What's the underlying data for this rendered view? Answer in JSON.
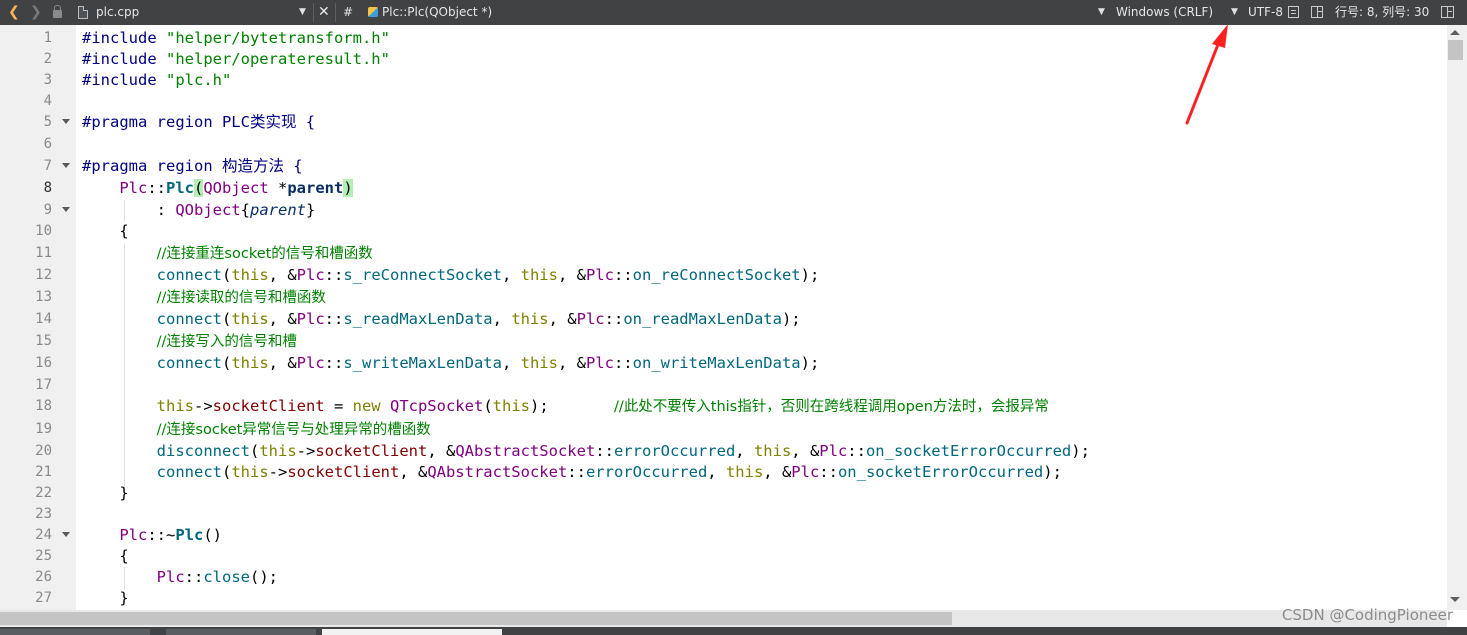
{
  "toolbar": {
    "back_glyph": "❮",
    "forward_glyph": "❯",
    "file_name": "plc.cpp",
    "close_glyph": "✕",
    "hash_glyph": "#",
    "symbol": "Plc::Plc(QObject *)",
    "line_ending": "Windows (CRLF)",
    "encoding": "UTF-8",
    "position": "行号: 8, 列号: 30",
    "dropdown_caret": "▼"
  },
  "editor": {
    "current_line": 8,
    "line_numbers": [
      "1",
      "2",
      "3",
      "4",
      "5",
      "6",
      "7",
      "8",
      "9",
      "10",
      "11",
      "12",
      "13",
      "14",
      "15",
      "16",
      "17",
      "18",
      "19",
      "20",
      "21",
      "22",
      "23",
      "24",
      "25",
      "26",
      "27"
    ],
    "lines": {
      "l1": {
        "kw": "#include",
        "rest": " \"helper/bytetransform.h\""
      },
      "l2": {
        "kw": "#include",
        "rest": " \"helper/operateresult.h\""
      },
      "l3": {
        "kw": "#include",
        "rest": " \"plc.h\""
      },
      "l5": {
        "text": "#pragma region PLC类实现 {"
      },
      "l7": {
        "text": "#pragma region 构造方法 {"
      },
      "l8": {
        "cls": "Plc",
        "sep": "::",
        "fn": "Plc",
        "open": "(",
        "type": "QObject",
        "star": " *",
        "param": "parent",
        "close": ")"
      },
      "l9": {
        "colon": ": ",
        "cls": "QObject",
        "open": "{",
        "param": "parent",
        "close": "}"
      },
      "l10": {
        "text": "{"
      },
      "l11": {
        "comment": "//连接重连socket的信号和槽函数"
      },
      "l12": {
        "fn": "connect",
        "a": "(",
        "this1": "this",
        "b": ", &",
        "cls1": "Plc",
        "c": "::",
        "sig": "s_reConnectSocket",
        "d": ", ",
        "this2": "this",
        "e": ", &",
        "cls2": "Plc",
        "f": "::",
        "slot": "on_reConnectSocket",
        "g": ");"
      },
      "l13": {
        "comment": "//连接读取的信号和槽函数"
      },
      "l14": {
        "fn": "connect",
        "a": "(",
        "this1": "this",
        "b": ", &",
        "cls1": "Plc",
        "c": "::",
        "sig": "s_readMaxLenData",
        "d": ", ",
        "this2": "this",
        "e": ", &",
        "cls2": "Plc",
        "f": "::",
        "slot": "on_readMaxLenData",
        "g": ");"
      },
      "l15": {
        "comment": "//连接写入的信号和槽"
      },
      "l16": {
        "fn": "connect",
        "a": "(",
        "this1": "this",
        "b": ", &",
        "cls1": "Plc",
        "c": "::",
        "sig": "s_writeMaxLenData",
        "d": ", ",
        "this2": "this",
        "e": ", &",
        "cls2": "Plc",
        "f": "::",
        "slot": "on_writeMaxLenData",
        "g": ");"
      },
      "l18": {
        "this1": "this",
        "arrow": "->",
        "memb": "socketClient",
        "eq": " = ",
        "kw": "new",
        "sp": " ",
        "cls": "QTcpSocket",
        "a": "(",
        "this2": "this",
        "b": ");",
        "gap": "       ",
        "comment": "//此处不要传入this指针，否则在跨线程调用open方法时，会报异常"
      },
      "l19": {
        "comment": "//连接socket异常信号与处理异常的槽函数"
      },
      "l20": {
        "fn": "disconnect",
        "a": "(",
        "this1": "this",
        "arrow": "->",
        "memb": "socketClient",
        "b": ", &",
        "cls1": "QAbstractSocket",
        "c": "::",
        "sig": "errorOccurred",
        "d": ", ",
        "this2": "this",
        "e": ", &",
        "cls2": "Plc",
        "f": "::",
        "slot": "on_socketErrorOccurred",
        "g": ");"
      },
      "l21": {
        "fn": "connect",
        "a": "(",
        "this1": "this",
        "arrow": "->",
        "memb": "socketClient",
        "b": ", &",
        "cls1": "QAbstractSocket",
        "c": "::",
        "sig": "errorOccurred",
        "d": ", ",
        "this2": "this",
        "e": ", &",
        "cls2": "Plc",
        "f": "::",
        "slot": "on_socketErrorOccurred",
        "g": ");"
      },
      "l22": {
        "text": "}"
      },
      "l24": {
        "cls": "Plc",
        "sep": "::~",
        "fn": "Plc",
        "parens": "()"
      },
      "l25": {
        "text": "{"
      },
      "l26": {
        "cls": "Plc",
        "sep": "::",
        "fn": "close",
        "rest": "();"
      },
      "l27": {
        "text": "}"
      }
    }
  },
  "watermark": "CSDN @CodingPioneer",
  "colors": {
    "toolbar_bg": "#404244",
    "keyword": "#808000",
    "preprocessor": "#000080",
    "string": "#008000",
    "class": "#800080",
    "function": "#00677c",
    "member": "#800000",
    "comment": "#008000",
    "arrow_annotation": "#ff2020"
  }
}
